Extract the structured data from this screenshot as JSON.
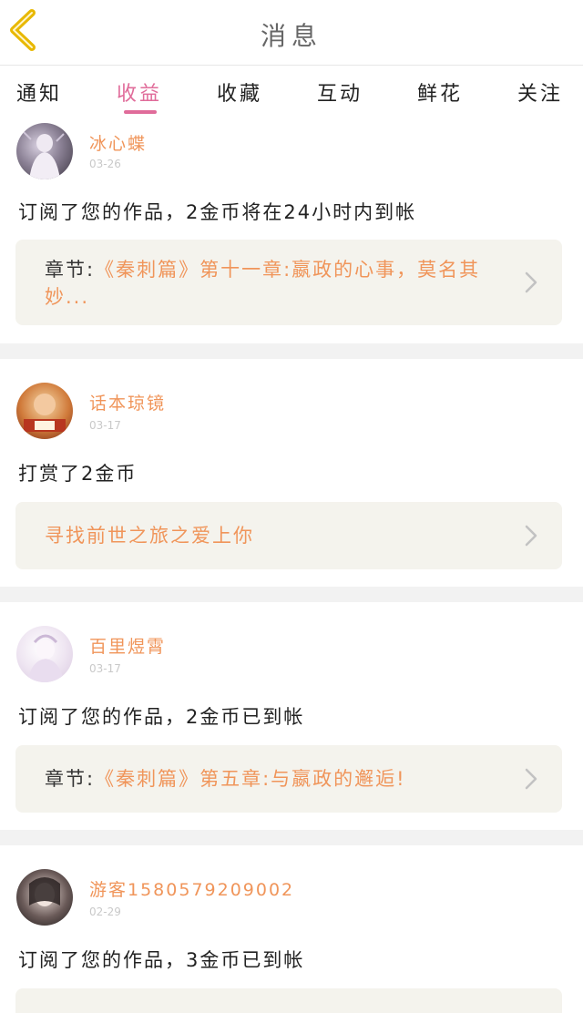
{
  "header": {
    "title": "消息"
  },
  "tabs": [
    {
      "label": "通知"
    },
    {
      "label": "收益"
    },
    {
      "label": "收藏"
    },
    {
      "label": "互动"
    },
    {
      "label": "鲜花"
    },
    {
      "label": "关注"
    }
  ],
  "active_tab": "收益",
  "colors": {
    "accent": "#e06c9a",
    "username": "#f0955a",
    "link_bg": "#f4f3ed"
  },
  "items": [
    {
      "user": "冰心蝶",
      "date": "03-26",
      "message": "订阅了您的作品，2金币将在24小时内到帐",
      "link_prefix": "章节:",
      "link_text": "《秦刺篇》第十一章:嬴政的心事，莫名其妙...",
      "avatar_icon": "user-avatar-icon"
    },
    {
      "user": "话本琼镜",
      "date": "03-17",
      "message": "打赏了2金币",
      "link_prefix": "",
      "link_text": "寻找前世之旅之爱上你",
      "avatar_icon": "user-avatar-icon"
    },
    {
      "user": "百里煜霄",
      "date": "03-17",
      "message": "订阅了您的作品，2金币已到帐",
      "link_prefix": "章节:",
      "link_text": "《秦刺篇》第五章:与嬴政的邂逅!",
      "avatar_icon": "user-avatar-icon"
    },
    {
      "user": "游客1580579209002",
      "date": "02-29",
      "message": "订阅了您的作品，3金币已到帐",
      "link_prefix": "",
      "link_text": "",
      "avatar_icon": "user-avatar-icon"
    }
  ]
}
